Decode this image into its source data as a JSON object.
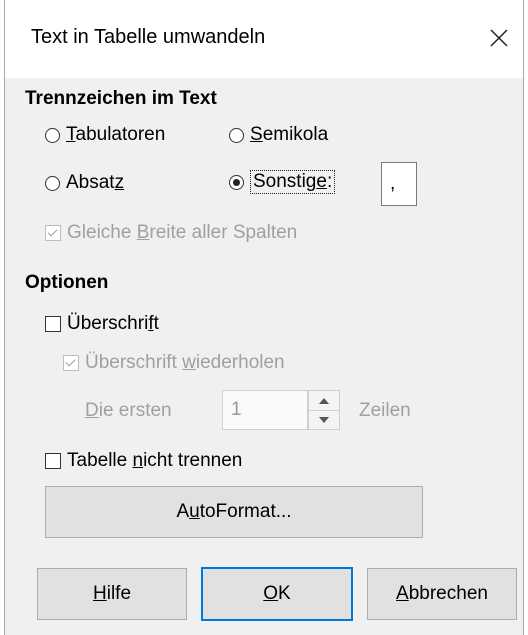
{
  "dialog": {
    "title_text": "Text in Tabelle umwandeln",
    "close_icon": "close-icon"
  },
  "separators": {
    "heading": "Trennzeichen im Text",
    "tabs": {
      "pre": "",
      "key": "T",
      "post": "abulatoren"
    },
    "semicolons": {
      "pre": "",
      "key": "S",
      "post": "emikola"
    },
    "paragraph": {
      "pre": "Absat",
      "key": "z",
      "post": ""
    },
    "other": {
      "pre": "Sonstig",
      "key": "e",
      "post": ":"
    },
    "other_value": ",",
    "selected": "other",
    "equal_width": {
      "pre": "Gleiche ",
      "key": "B",
      "post": "reite aller Spalten"
    },
    "equal_width_checked": true
  },
  "options": {
    "heading": "Optionen",
    "heading_cb": {
      "pre": "Überschri",
      "key": "f",
      "post": "t"
    },
    "heading_checked": false,
    "repeat_heading": {
      "pre": "Überschrift ",
      "key": "w",
      "post": "iederholen"
    },
    "repeat_heading_checked": true,
    "first_label": {
      "pre": "",
      "key": "D",
      "post": "ie ersten"
    },
    "rows_value": "1",
    "rows_unit": "Zeilen",
    "dont_split": {
      "pre": "Tabelle ",
      "key": "n",
      "post": "icht trennen"
    },
    "dont_split_checked": false
  },
  "buttons": {
    "autoformat": {
      "pre": "A",
      "key": "u",
      "post": "toFormat..."
    },
    "help": {
      "pre": "",
      "key": "H",
      "post": "ilfe"
    },
    "ok": {
      "pre": "",
      "key": "O",
      "post": "K"
    },
    "cancel": {
      "pre": "",
      "key": "A",
      "post": "bbrechen"
    }
  },
  "colors": {
    "default_button_border": "#0078d7",
    "dialog_bg": "#f0f0f0",
    "disabled_text": "#a0a0a0"
  }
}
